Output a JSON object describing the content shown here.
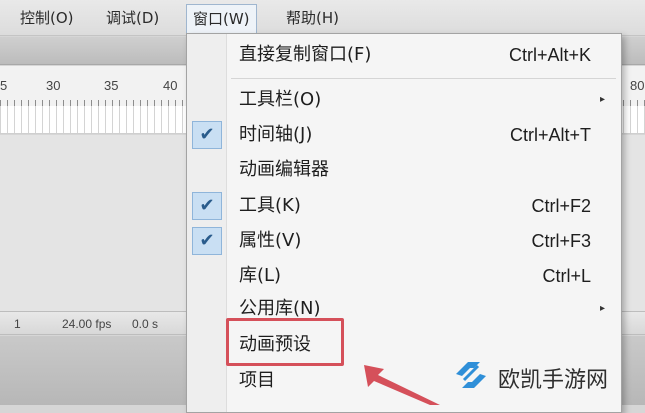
{
  "menubar": {
    "items": [
      {
        "label": "控制(O)"
      },
      {
        "label": "调试(D)"
      },
      {
        "label": "窗口(W)"
      },
      {
        "label": "帮助(H)"
      }
    ]
  },
  "ruler": {
    "numbers": [
      "5",
      "30",
      "35",
      "40",
      "80"
    ]
  },
  "status": {
    "frame": "1",
    "fps": "24.00 fps",
    "time": "0.0 s"
  },
  "dropdown": {
    "items": [
      {
        "label": "直接复制窗口(F)",
        "shortcut": "Ctrl+Alt+K"
      },
      {
        "label": "工具栏(O)",
        "submenu": "▸"
      },
      {
        "label": "时间轴(J)",
        "shortcut": "Ctrl+Alt+T",
        "check": "✔"
      },
      {
        "label": "动画编辑器"
      },
      {
        "label": "工具(K)",
        "shortcut": "Ctrl+F2",
        "check": "✔"
      },
      {
        "label": "属性(V)",
        "shortcut": "Ctrl+F3",
        "check": "✔"
      },
      {
        "label": "库(L)",
        "shortcut": "Ctrl+L"
      },
      {
        "label": "公用库(N)",
        "submenu": "▸"
      },
      {
        "label": "动画预设"
      },
      {
        "label": "项目"
      }
    ]
  },
  "watermark": {
    "text": "欧凯手游网"
  },
  "colors": {
    "highlight": "#d5505a",
    "arrow": "#d5505a",
    "check_bg": "#c9dff3"
  }
}
